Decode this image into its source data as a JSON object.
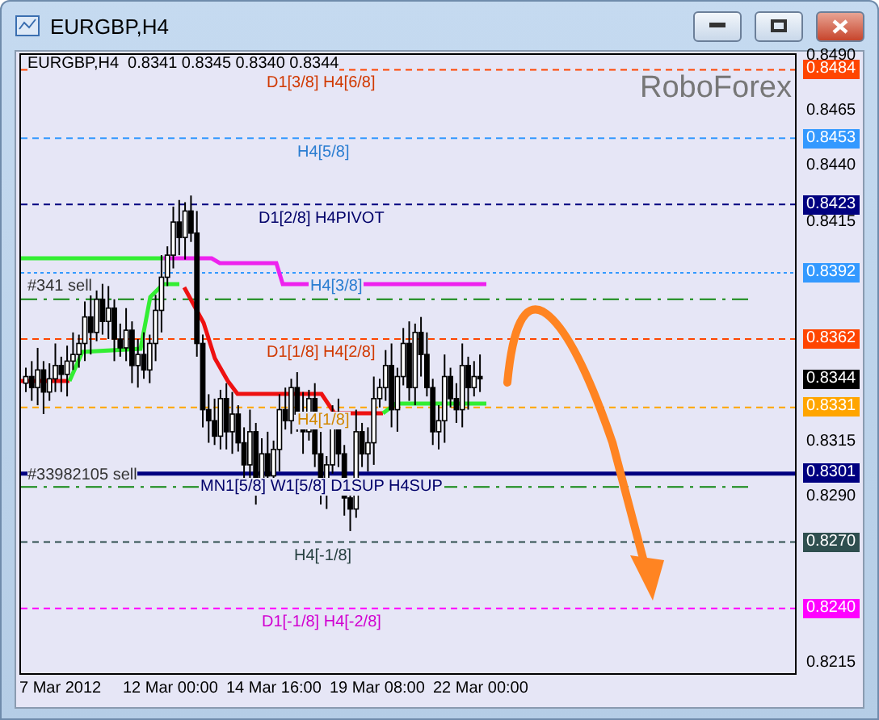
{
  "window": {
    "title": "EURGBP,H4"
  },
  "chart": {
    "header": "EURGBP,H4  0.8341 0.8345 0.8340 0.8344",
    "logo": "RoboForex",
    "levels": [
      {
        "label": "D1[3/8] H4[6/8]",
        "tag": "0.8484",
        "color": "#ff4500",
        "kind": "dashed"
      },
      {
        "label": "H4[5/8]",
        "tag": "0.8453",
        "color": "#3399ff",
        "kind": "dashed"
      },
      {
        "label": "D1[2/8] H4PIVOT",
        "tag": "0.8423",
        "color": "#000080",
        "kind": "dashed"
      },
      {
        "label": "H4[3/8]",
        "tag": "0.8392",
        "color": "#3399ff",
        "kind": "dotted"
      },
      {
        "label": "D1[1/8] H4[2/8]",
        "tag": "0.8362",
        "color": "#ff4500",
        "kind": "dashed"
      },
      {
        "label": "H4[1/8]",
        "tag": "0.8331",
        "color": "#ffa500",
        "kind": "dashed"
      },
      {
        "label": "MN1[5/8] W1[5/8] D1SUP H4SUP",
        "tag": "0.8301",
        "color": "#000080",
        "kind": "solid"
      },
      {
        "label": "H4[-1/8]",
        "tag": "0.8270",
        "color": "#2f4f4f",
        "kind": "dashed"
      },
      {
        "label": "D1[-1/8] H4[-2/8]",
        "tag": "0.8240",
        "color": "#ff00ff",
        "kind": "dashed"
      }
    ],
    "orders": [
      {
        "label": "#341 sell"
      },
      {
        "label": "#33982105 sell"
      }
    ],
    "current_price": "0.8344",
    "price_ticks": [
      "0.8490",
      "0.8465",
      "0.8440",
      "0.8415",
      "0.8315",
      "0.8290",
      "0.8215"
    ],
    "time_labels": [
      "7 Mar 2012",
      "12 Mar 00:00",
      "14 Mar 16:00",
      "19 Mar 08:00",
      "22 Mar 00:00"
    ]
  }
}
